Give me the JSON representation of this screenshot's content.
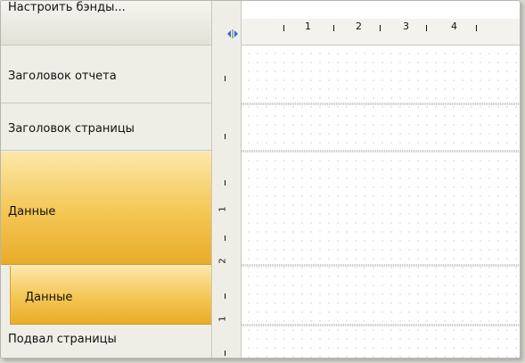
{
  "toolbar": {
    "configure_bands_label": "Настроить бэнды..."
  },
  "bands": [
    {
      "id": "report-title",
      "label": "Заголовок отчета"
    },
    {
      "id": "page-header",
      "label": "Заголовок страницы"
    },
    {
      "id": "data",
      "label": "Данные",
      "selected": true
    },
    {
      "id": "data-child",
      "label": "Данные",
      "nested": true,
      "selected": true
    },
    {
      "id": "page-footer",
      "label": "Подвал страницы"
    }
  ],
  "ruler": {
    "horizontal_numbers": [
      "1",
      "2",
      "3",
      "4"
    ],
    "vertical_numbers": [
      "1",
      "2",
      "1"
    ]
  },
  "colors": {
    "band_highlight": "#f4c653",
    "splitter_accent": "#2f6fd0"
  }
}
